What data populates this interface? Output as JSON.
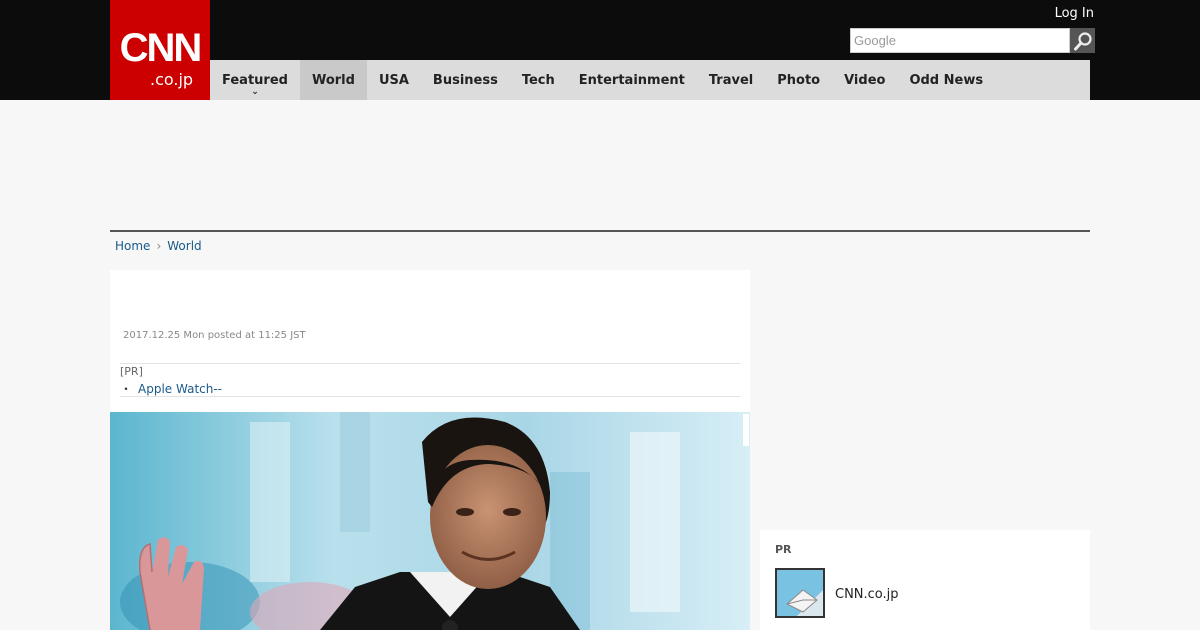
{
  "header": {
    "logo_main": "CNN",
    "logo_sub": ".co.jp",
    "login_label": "Log In",
    "search_placeholder": "Google",
    "search_icon": "magnifier-icon"
  },
  "nav": {
    "items": [
      {
        "label": "Featured"
      },
      {
        "label": "World"
      },
      {
        "label": "USA"
      },
      {
        "label": "Business"
      },
      {
        "label": "Tech"
      },
      {
        "label": "Entertainment"
      },
      {
        "label": "Travel"
      },
      {
        "label": "Photo"
      },
      {
        "label": "Video"
      },
      {
        "label": "Odd News"
      }
    ],
    "active": "World",
    "chevron_glyph": "⌄"
  },
  "breadcrumb": {
    "home": "Home",
    "separator": "›",
    "current": "World"
  },
  "article": {
    "dateline": "2017.12.25 Mon posted at 11:25 JST",
    "pr_label": "[PR]",
    "pr_bullet": "・",
    "pr_link": "Apple Watch--"
  },
  "sidebar_pr": {
    "label": "PR",
    "item_title": "CNN.co.jp"
  },
  "colors": {
    "brand_red": "#cc0000",
    "header_black": "#0c0c0c",
    "nav_gray": "#dcdcdc",
    "link_blue": "#1a5a8a"
  }
}
